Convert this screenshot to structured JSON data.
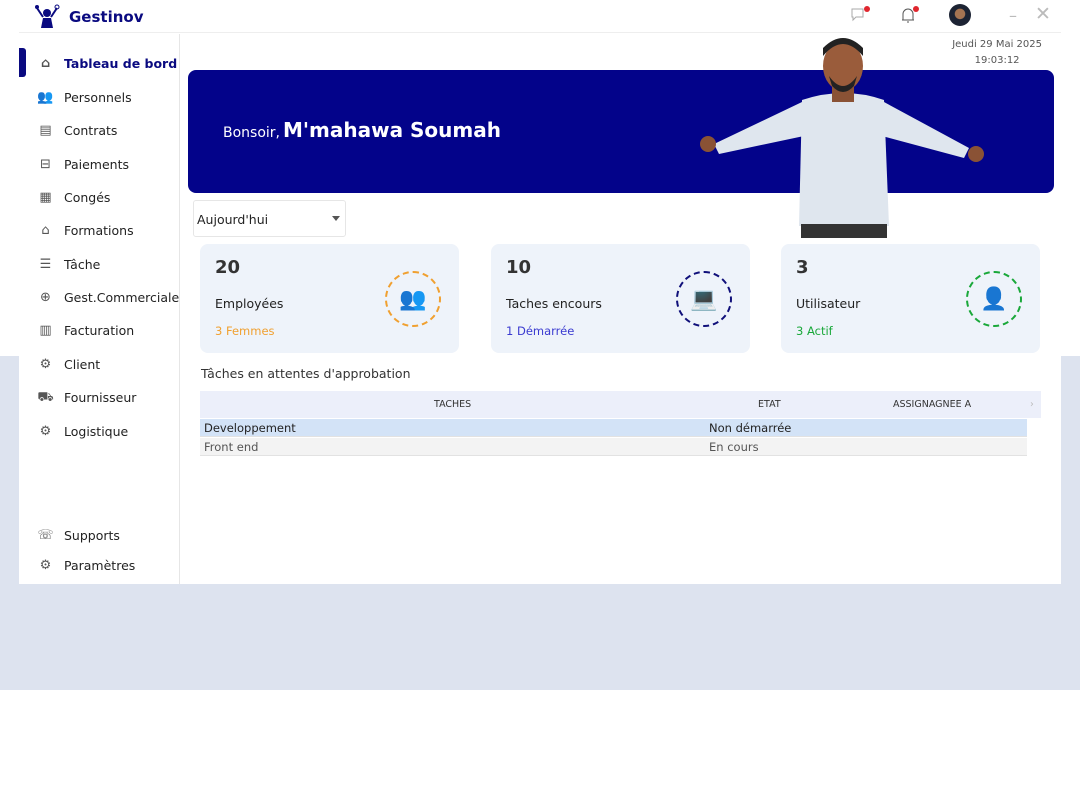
{
  "app": {
    "name": "Gestinov"
  },
  "header": {
    "datetime_date": "Jeudi 29 Mai 2025",
    "datetime_time": "19:03:12"
  },
  "sidebar": {
    "items": [
      {
        "label": "Tableau de bord",
        "icon": "home-icon"
      },
      {
        "label": "Personnels",
        "icon": "staff-icon"
      },
      {
        "label": "Contrats",
        "icon": "contract-icon"
      },
      {
        "label": "Paiements",
        "icon": "payment-icon"
      },
      {
        "label": "Congés",
        "icon": "calendar-icon"
      },
      {
        "label": "Formations",
        "icon": "graduation-icon"
      },
      {
        "label": "Tâche",
        "icon": "task-icon"
      },
      {
        "label": "Gest.Commerciale",
        "icon": "commerce-icon"
      },
      {
        "label": "Facturation",
        "icon": "invoice-icon"
      },
      {
        "label": "Client",
        "icon": "client-icon"
      },
      {
        "label": "Fournisseur",
        "icon": "supplier-icon"
      },
      {
        "label": "Logistique",
        "icon": "logistics-icon"
      }
    ],
    "bottom": [
      {
        "label": "Supports",
        "icon": "support-icon"
      },
      {
        "label": "Paramètres",
        "icon": "settings-icon"
      }
    ]
  },
  "banner": {
    "greeting": "Bonsoir,",
    "user": "M'mahawa Soumah"
  },
  "filter": {
    "selected": "Aujourd'hui"
  },
  "cards": [
    {
      "value": "20",
      "label": "Employées",
      "sub": "3 Femmes",
      "color": "#f0a030"
    },
    {
      "value": "10",
      "label": "Taches encours",
      "sub": "1 Démarrée",
      "color": "#10107a"
    },
    {
      "value": "3",
      "label": "Utilisateur",
      "sub": "3 Actif",
      "color": "#1aa83a"
    }
  ],
  "table": {
    "title": "Tâches en attentes d'approbation",
    "columns": [
      "TACHES",
      "ETAT",
      "ASSIGNAGNEE A"
    ],
    "rows": [
      {
        "task": "Developpement",
        "state": "Non démarrée",
        "assignee": ""
      },
      {
        "task": "Front end",
        "state": "En cours",
        "assignee": ""
      }
    ]
  }
}
